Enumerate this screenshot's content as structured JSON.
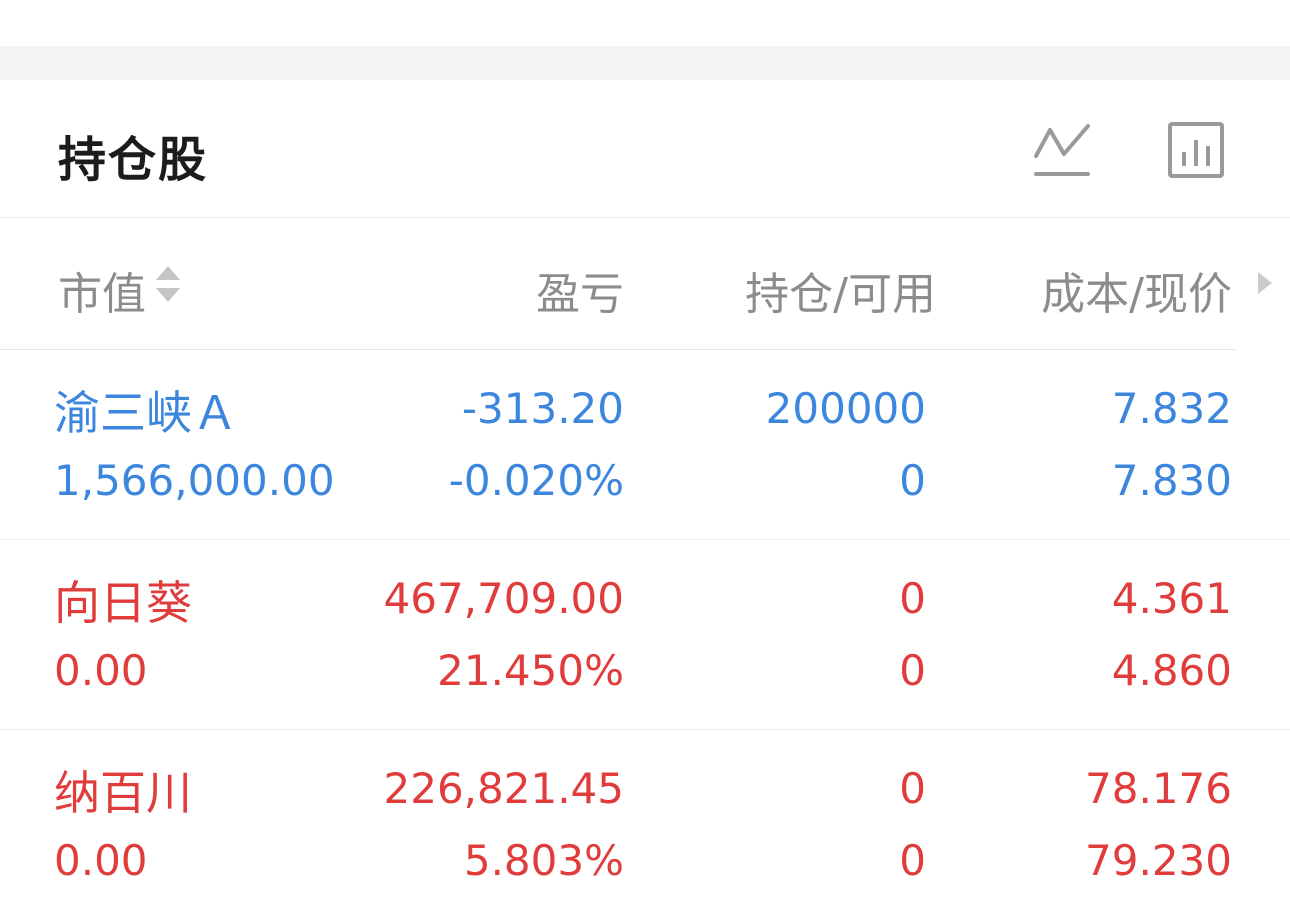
{
  "section": {
    "title": "持仓股",
    "icons": [
      "line-chart-icon",
      "bar-chart-icon"
    ]
  },
  "columns": {
    "market_value": "市值",
    "profit_loss": "盈亏",
    "position_available": "持仓/可用",
    "cost_price": "成本/现价"
  },
  "colors": {
    "down": "#3d86de",
    "up": "#e03c3c",
    "header_text": "#8c8c8c",
    "title": "#1c1c1c"
  },
  "holdings": [
    {
      "name": "渝三峡Ａ",
      "market_value": "1,566,000.00",
      "pl_amount": "-313.20",
      "pl_percent": "-0.020%",
      "position": "200000",
      "available": "0",
      "cost": "7.832",
      "price": "7.830",
      "trend": "down"
    },
    {
      "name": "向日葵",
      "market_value": "0.00",
      "pl_amount": "467,709.00",
      "pl_percent": "21.450%",
      "position": "0",
      "available": "0",
      "cost": "4.361",
      "price": "4.860",
      "trend": "up"
    },
    {
      "name": "纳百川",
      "market_value": "0.00",
      "pl_amount": "226,821.45",
      "pl_percent": "5.803%",
      "position": "0",
      "available": "0",
      "cost": "78.176",
      "price": "79.230",
      "trend": "up"
    }
  ]
}
